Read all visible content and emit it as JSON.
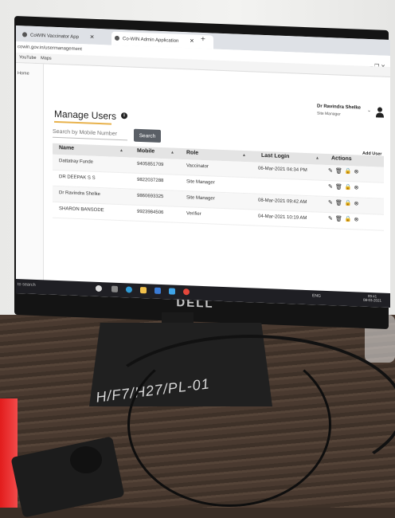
{
  "browser": {
    "tabs": [
      {
        "label": "CoWIN Vaccinator App",
        "active": false
      },
      {
        "label": "Co-WIN Admin Application",
        "active": true
      }
    ],
    "new_tab": "+",
    "address": "cowin.gov.in/usermanagement",
    "bookmarks": [
      "YouTube",
      "Maps"
    ],
    "window_controls": "–  ❐  ✕"
  },
  "sidebar": {
    "items": [
      "Home"
    ]
  },
  "header": {
    "user_name": "Dr Ravindra Shelke",
    "user_role": "Site Manager"
  },
  "page": {
    "title": "Manage Users",
    "info_icon": "i",
    "search_placeholder": "Search by Mobile Number",
    "search_button": "Search",
    "add_user": "Add User"
  },
  "table": {
    "columns": [
      "Name",
      "Mobile",
      "Role",
      "Last Login",
      "Actions"
    ],
    "rows": [
      {
        "name": "Dattatray Funde",
        "mobile": "9405851709",
        "role": "Vaccinator",
        "last_login": "06-Mar-2021 04:34 PM"
      },
      {
        "name": "DR DEEPAK S S",
        "mobile": "9822037288",
        "role": "Site Manager",
        "last_login": ""
      },
      {
        "name": "Dr Ravindra Shelke",
        "mobile": "9860693325",
        "role": "Site Manager",
        "last_login": "08-Mar-2021 09:42 AM"
      },
      {
        "name": "SHARON BANSODE",
        "mobile": "9923984506",
        "role": "Verifier",
        "last_login": "04-Mar-2021 10:19 AM"
      }
    ],
    "action_icons": [
      "edit-icon",
      "delete-icon",
      "lock-icon",
      "user-remove-icon"
    ]
  },
  "taskbar": {
    "search": "to search",
    "tray": "ENG",
    "time": "09:41",
    "date": "08-03-2021"
  },
  "monitor": {
    "brand": "DELL",
    "base_marking": "H/F7/H27/PL-01"
  },
  "colors": {
    "accent": "#e8b24c",
    "search_button": "#5a5f66",
    "header_bg": "#e4e4e4"
  }
}
